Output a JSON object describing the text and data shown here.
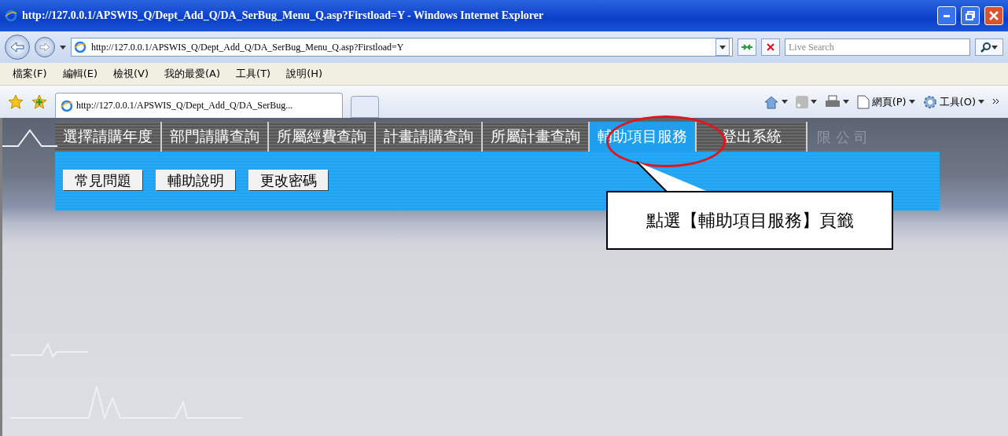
{
  "window": {
    "title": "http://127.0.0.1/APSWIS_Q/Dept_Add_Q/DA_SerBug_Menu_Q.asp?Firstload=Y - Windows Internet Explorer"
  },
  "address_bar": {
    "value": "http://127.0.0.1/APSWIS_Q/Dept_Add_Q/DA_SerBug_Menu_Q.asp?Firstload=Y"
  },
  "search": {
    "placeholder": "Live Search"
  },
  "menu": [
    "檔案(F)",
    "編輯(E)",
    "檢視(V)",
    "我的最愛(A)",
    "工具(T)",
    "說明(H)"
  ],
  "browser_tab": {
    "label": "http://127.0.0.1/APSWIS_Q/Dept_Add_Q/DA_SerBug..."
  },
  "command_bar": [
    {
      "kind": "home"
    },
    {
      "kind": "feeds",
      "disabled": true
    },
    {
      "kind": "print"
    },
    {
      "kind": "page",
      "label": "網頁(P)"
    },
    {
      "kind": "tools",
      "label": "工具(O)"
    }
  ],
  "page": {
    "background_text": "限 公 司",
    "tabs": [
      {
        "label": "選擇請購年度",
        "selected": false
      },
      {
        "label": "部門請購查詢",
        "selected": false
      },
      {
        "label": "所屬經費查詢",
        "selected": false
      },
      {
        "label": "計畫請購查詢",
        "selected": false
      },
      {
        "label": "所屬計畫查詢",
        "selected": false
      },
      {
        "label": "輔助項目服務",
        "selected": true
      },
      {
        "label": "登出系統",
        "selected": false
      }
    ],
    "buttons": [
      "常見問題",
      "輔助說明",
      "更改密碼"
    ]
  },
  "callout": {
    "text": "點選【輔助項目服務】頁籤"
  }
}
